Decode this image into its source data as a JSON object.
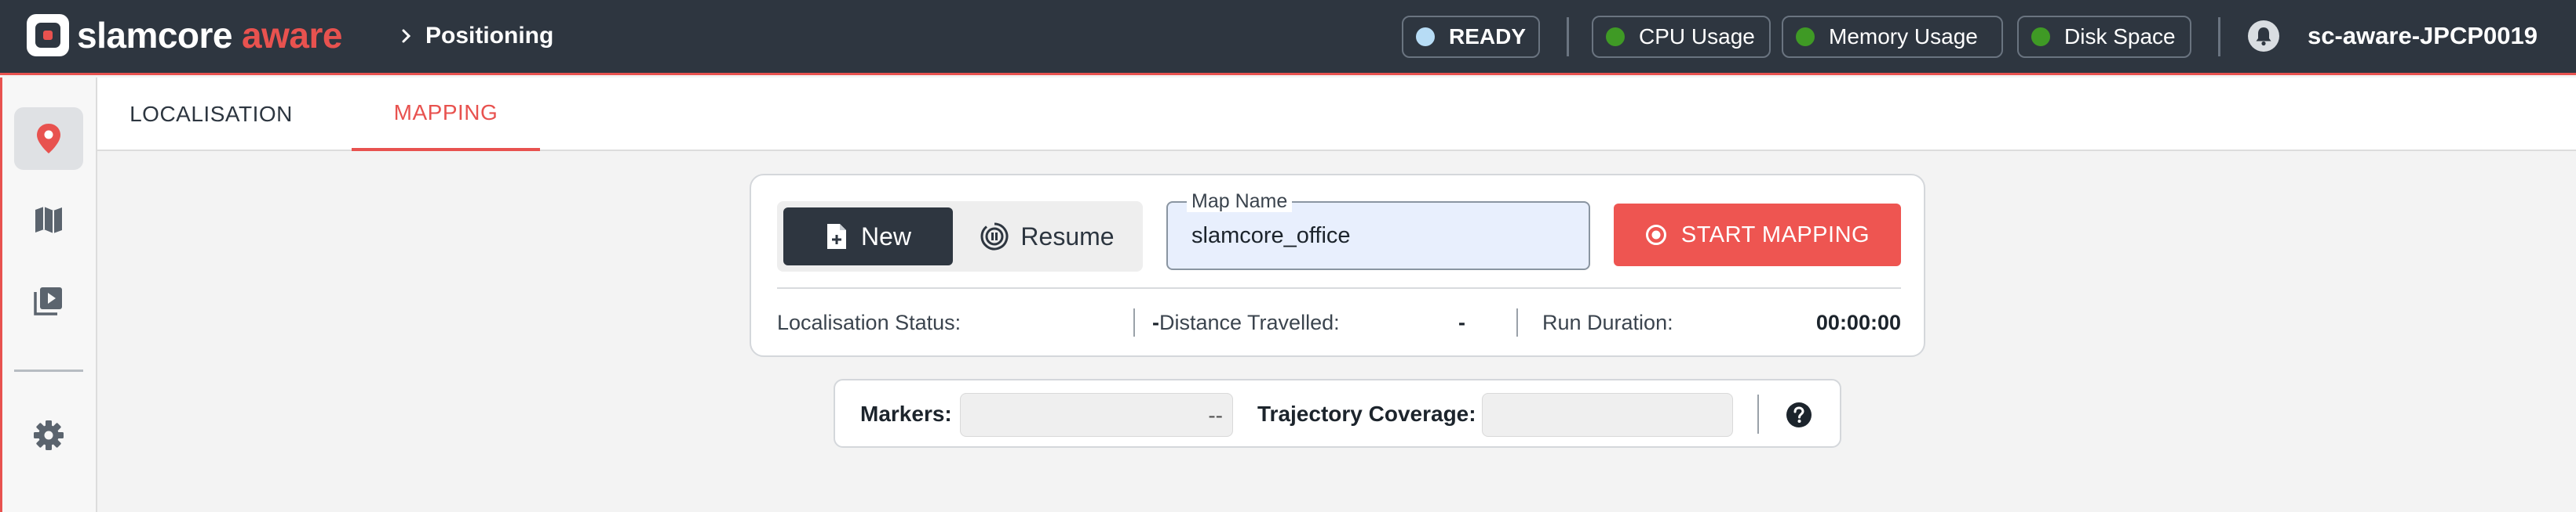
{
  "app": {
    "brand_primary": "slamcore",
    "brand_secondary": "aware",
    "breadcrumb": "Positioning",
    "colors": {
      "header_bg": "#2e3640",
      "accent": "#e8524f",
      "status_ready": "#b7dcf5",
      "status_ok": "#3f9a25"
    }
  },
  "status": {
    "ready": "READY",
    "cpu": "CPU Usage",
    "memory": "Memory Usage",
    "disk": "Disk Space"
  },
  "device_name": "sc-aware-JPCP0019",
  "sidebar": {
    "items": [
      {
        "icon": "location-pin-icon",
        "active": true
      },
      {
        "icon": "map-icon",
        "active": false
      },
      {
        "icon": "playlist-play-icon",
        "active": false
      },
      {
        "icon": "gear-icon",
        "active": false
      }
    ]
  },
  "tabs": [
    {
      "label": "LOCALISATION",
      "active": false
    },
    {
      "label": "MAPPING",
      "active": true
    }
  ],
  "mapping": {
    "new_label": "New",
    "resume_label": "Resume",
    "map_name_label": "Map Name",
    "map_name_value": "slamcore_office",
    "start_label": "START MAPPING"
  },
  "stats": {
    "localisation_status_label": "Localisation Status:",
    "localisation_status_value": "-",
    "distance_label": "Distance Travelled:",
    "distance_value": "-",
    "run_duration_label": "Run Duration:",
    "run_duration_value": "00:00:00"
  },
  "markers": {
    "markers_label": "Markers:",
    "markers_value": "--",
    "trajectory_label": "Trajectory Coverage:",
    "trajectory_value": ""
  }
}
